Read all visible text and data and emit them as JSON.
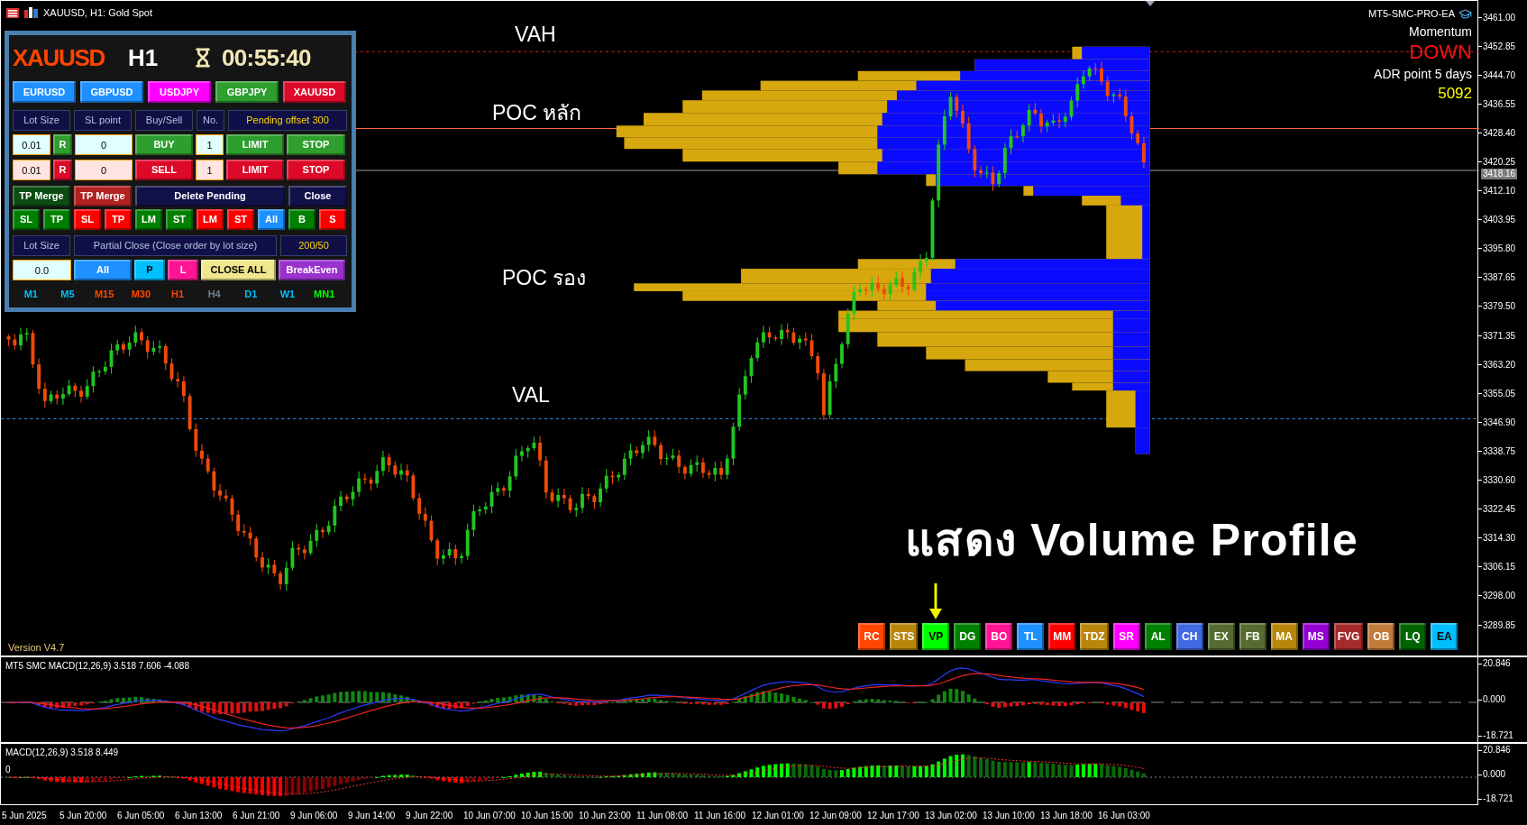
{
  "window": {
    "title": "XAUUSD, H1: Gold Spot"
  },
  "panel": {
    "symbol": "XAUUSD",
    "timeframe": "H1",
    "timer": "00:55:40",
    "symbols": [
      {
        "label": "EURUSD",
        "color": "#1e90ff"
      },
      {
        "label": "GBPUSD",
        "color": "#1e90ff"
      },
      {
        "label": "USDJPY",
        "color": "#ff00ff"
      },
      {
        "label": "GBPJPY",
        "color": "#2e9e2e"
      },
      {
        "label": "XAUUSD",
        "color": "#dc0a28"
      }
    ],
    "rows": [
      {
        "items": [
          {
            "text": "Lot Size",
            "kind": "label",
            "highlight": false
          },
          {
            "text": "SL point",
            "kind": "label",
            "highlight": false
          },
          {
            "text": "Buy/Sell",
            "kind": "label",
            "highlight": false
          },
          {
            "text": "No.",
            "kind": "label",
            "highlight": false
          },
          {
            "text": "Pending offset 300",
            "kind": "label",
            "highlight": true
          }
        ]
      },
      {
        "items": [
          {
            "text": "0.01",
            "kind": "input",
            "color": "#e0ffff"
          },
          {
            "text": "R",
            "kind": "button",
            "color": "#2e9e2e"
          },
          {
            "text": "0",
            "kind": "input",
            "color": "#e0ffff"
          },
          {
            "text": "BUY",
            "kind": "button",
            "color": "#2e9e2e"
          },
          {
            "text": "1",
            "kind": "input",
            "color": "#e0ffff"
          },
          {
            "text": "LIMIT",
            "kind": "button",
            "color": "#2e9e2e"
          },
          {
            "text": "STOP",
            "kind": "button",
            "color": "#2e9e2e"
          }
        ]
      },
      {
        "items": [
          {
            "text": "0.01",
            "kind": "input",
            "color": "#ffe4e1"
          },
          {
            "text": "R",
            "kind": "button",
            "color": "#dc0a28"
          },
          {
            "text": "0",
            "kind": "input",
            "color": "#ffe4e1"
          },
          {
            "text": "SELL",
            "kind": "button",
            "color": "#dc0a28"
          },
          {
            "text": "1",
            "kind": "input",
            "color": "#ffe4e1"
          },
          {
            "text": "LIMIT",
            "kind": "button",
            "color": "#dc0a28"
          },
          {
            "text": "STOP",
            "kind": "button",
            "color": "#dc0a28"
          }
        ]
      },
      {
        "items": [
          {
            "text": "TP Merge",
            "kind": "button",
            "color": "#0b4d12"
          },
          {
            "text": "TP Merge",
            "kind": "button",
            "color": "#b22222"
          },
          {
            "text": "Delete Pending",
            "kind": "button",
            "color": "#12124a"
          },
          {
            "text": "Close",
            "kind": "button",
            "color": "#12124a"
          }
        ]
      },
      {
        "items": [
          {
            "text": "SL",
            "kind": "button",
            "color": "#008000"
          },
          {
            "text": "TP",
            "kind": "button",
            "color": "#008000"
          },
          {
            "text": "SL",
            "kind": "button",
            "color": "#ff0000"
          },
          {
            "text": "TP",
            "kind": "button",
            "color": "#ff0000"
          },
          {
            "text": "LM",
            "kind": "button",
            "color": "#008000"
          },
          {
            "text": "ST",
            "kind": "button",
            "color": "#008000"
          },
          {
            "text": "LM",
            "kind": "button",
            "color": "#ff0000"
          },
          {
            "text": "ST",
            "kind": "button",
            "color": "#ff0000"
          },
          {
            "text": "All",
            "kind": "button",
            "color": "#1e90ff"
          },
          {
            "text": "B",
            "kind": "button",
            "color": "#008000"
          },
          {
            "text": "S",
            "kind": "button",
            "color": "#ff0000"
          }
        ]
      },
      {
        "items": [
          {
            "text": "Lot Size",
            "kind": "label",
            "highlight": false
          },
          {
            "text": "Partial Close (Close order by lot size)",
            "kind": "label",
            "highlight": false
          },
          {
            "text": "200/50",
            "kind": "label",
            "highlight": true
          }
        ]
      },
      {
        "items": [
          {
            "text": "0.0",
            "kind": "input",
            "color": "#e0ffff"
          },
          {
            "text": "All",
            "kind": "button",
            "color": "#1e90ff"
          },
          {
            "text": "P",
            "kind": "button",
            "color": "#00bfff"
          },
          {
            "text": "L",
            "kind": "button",
            "color": "#ff1493"
          },
          {
            "text": "CLOSE ALL",
            "kind": "button",
            "color": "#f0e68c"
          },
          {
            "text": "BreakEven",
            "kind": "button",
            "color": "#9932cc"
          }
        ]
      }
    ],
    "timeframes": [
      {
        "label": "M1",
        "color": "#00bfff"
      },
      {
        "label": "M5",
        "color": "#00bfff"
      },
      {
        "label": "M15",
        "color": "#ff4500"
      },
      {
        "label": "M30",
        "color": "#ff4500"
      },
      {
        "label": "H1",
        "color": "#ff4500"
      },
      {
        "label": "H4",
        "color": "#708090"
      },
      {
        "label": "D1",
        "color": "#00bfff"
      },
      {
        "label": "W1",
        "color": "#00bfff"
      },
      {
        "label": "MN1",
        "color": "#00ff00"
      }
    ]
  },
  "ea": {
    "name": "MT5-SMC-PRO-EA",
    "momentum_label": "Momentum",
    "momentum": "DOWN",
    "adr_label": "ADR point 5 days",
    "adr": "5092"
  },
  "annotations": [
    "VAH",
    "POC หลัก",
    "POC รอง",
    "VAL"
  ],
  "caption": "แสดง Volume Profile",
  "version": "Version V4.7",
  "toolbar": [
    {
      "label": "RC",
      "color": "#ff4500",
      "selected": false
    },
    {
      "label": "STS",
      "color": "#b8860b",
      "selected": false
    },
    {
      "label": "VP",
      "color": "#00ff00",
      "selected": true
    },
    {
      "label": "DG",
      "color": "#008000",
      "selected": false
    },
    {
      "label": "BO",
      "color": "#ff1493",
      "selected": false
    },
    {
      "label": "TL",
      "color": "#1e90ff",
      "selected": false
    },
    {
      "label": "MM",
      "color": "#ff0000",
      "selected": false
    },
    {
      "label": "TDZ",
      "color": "#b8860b",
      "selected": false
    },
    {
      "label": "SR",
      "color": "#ff00ff",
      "selected": false
    },
    {
      "label": "AL",
      "color": "#008000",
      "selected": false
    },
    {
      "label": "CH",
      "color": "#4169e1",
      "selected": false
    },
    {
      "label": "EX",
      "color": "#556b2f",
      "selected": false
    },
    {
      "label": "FB",
      "color": "#556b2f",
      "selected": false
    },
    {
      "label": "MA",
      "color": "#b8860b",
      "selected": false
    },
    {
      "label": "MS",
      "color": "#9400d3",
      "selected": false
    },
    {
      "label": "FVG",
      "color": "#a52a2a",
      "selected": false
    },
    {
      "label": "OB",
      "color": "#c07a3a",
      "selected": false
    },
    {
      "label": "LQ",
      "color": "#006400",
      "selected": false
    },
    {
      "label": "EA",
      "color": "#00bfff",
      "selected": false
    }
  ],
  "price_axis": [
    "3461.00",
    "3452.85",
    "3444.70",
    "3436.55",
    "3428.40",
    "3420.25",
    "3412.10",
    "3403.95",
    "3395.80",
    "3387.65",
    "3379.50",
    "3371.35",
    "3363.20",
    "3355.05",
    "3346.90",
    "3338.75",
    "3330.60",
    "3322.45",
    "3314.30",
    "3306.15",
    "3298.00",
    "3289.85"
  ],
  "current_price": "3418.16",
  "indicators": [
    {
      "title": "MT5 SMC MACD(12,26,9) 3.518 7.606 -4.088",
      "axis": [
        "20.846",
        "0.000",
        "-18.721"
      ]
    },
    {
      "title": "MACD(12,26,9) 3.518 8.449",
      "zero_label": "0",
      "axis": [
        "20.846",
        "0.000",
        "-18.721"
      ]
    }
  ],
  "time_axis": [
    "5 Jun 2025",
    "5 Jun 20:00",
    "6 Jun 05:00",
    "6 Jun 13:00",
    "6 Jun 21:00",
    "9 Jun 06:00",
    "9 Jun 14:00",
    "9 Jun 22:00",
    "10 Jun 07:00",
    "10 Jun 15:00",
    "10 Jun 23:00",
    "11 Jun 08:00",
    "11 Jun 16:00",
    "12 Jun 01:00",
    "12 Jun 09:00",
    "12 Jun 17:00",
    "13 Jun 02:00",
    "13 Jun 10:00",
    "13 Jun 18:00",
    "16 Jun 03:00"
  ]
}
